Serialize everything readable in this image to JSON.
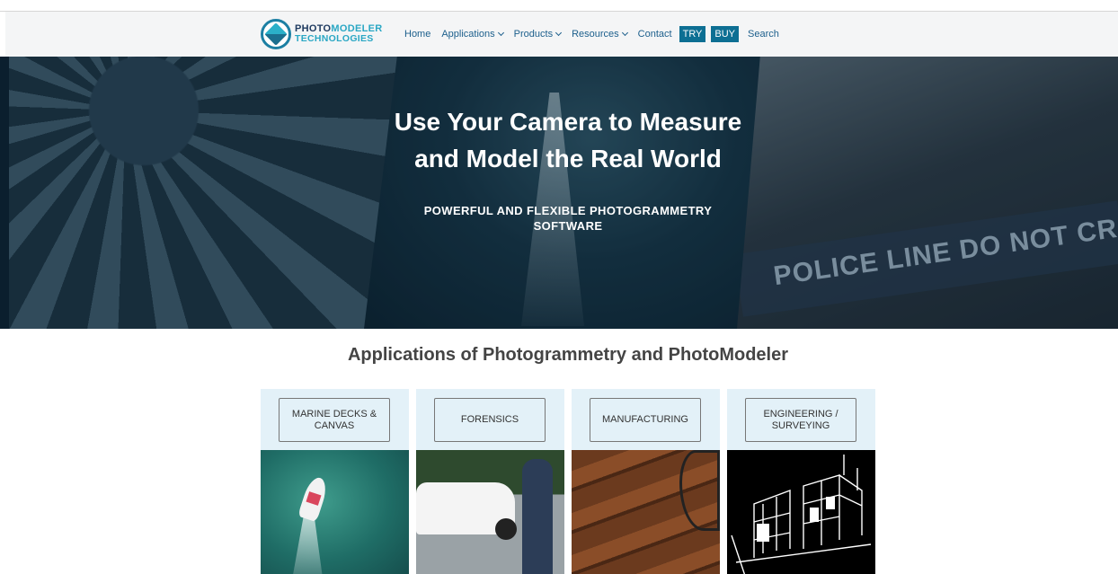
{
  "nav": {
    "logo_line1_a": "PHOTO",
    "logo_line1_b": "MODELER",
    "logo_line2": "TECHNOLOGIES",
    "items": [
      {
        "label": "Home",
        "dropdown": false
      },
      {
        "label": "Applications",
        "dropdown": true
      },
      {
        "label": "Products",
        "dropdown": true
      },
      {
        "label": "Resources",
        "dropdown": true
      },
      {
        "label": "Contact",
        "dropdown": false
      }
    ],
    "try_label": "TRY",
    "buy_label": "BUY",
    "search_label": "Search",
    "accent_color": "#0d6f93"
  },
  "hero": {
    "title_line1": "Use Your Camera to Measure",
    "title_line2": "and Model the Real World",
    "subtitle_line1": "POWERFUL AND FLEXIBLE PHOTOGRAMMETRY",
    "subtitle_line2": "SOFTWARE",
    "tape_text": "POLICE LINE DO NOT CROSS"
  },
  "applications": {
    "heading": "Applications of Photogrammetry and PhotoModeler",
    "cards": [
      {
        "label_line1": "MARINE DECKS &",
        "label_line2": "CANVAS"
      },
      {
        "label_line1": "FORENSICS",
        "label_line2": ""
      },
      {
        "label_line1": "MANUFACTURING",
        "label_line2": ""
      },
      {
        "label_line1": "ENGINEERING /",
        "label_line2": "SURVEYING"
      }
    ]
  }
}
